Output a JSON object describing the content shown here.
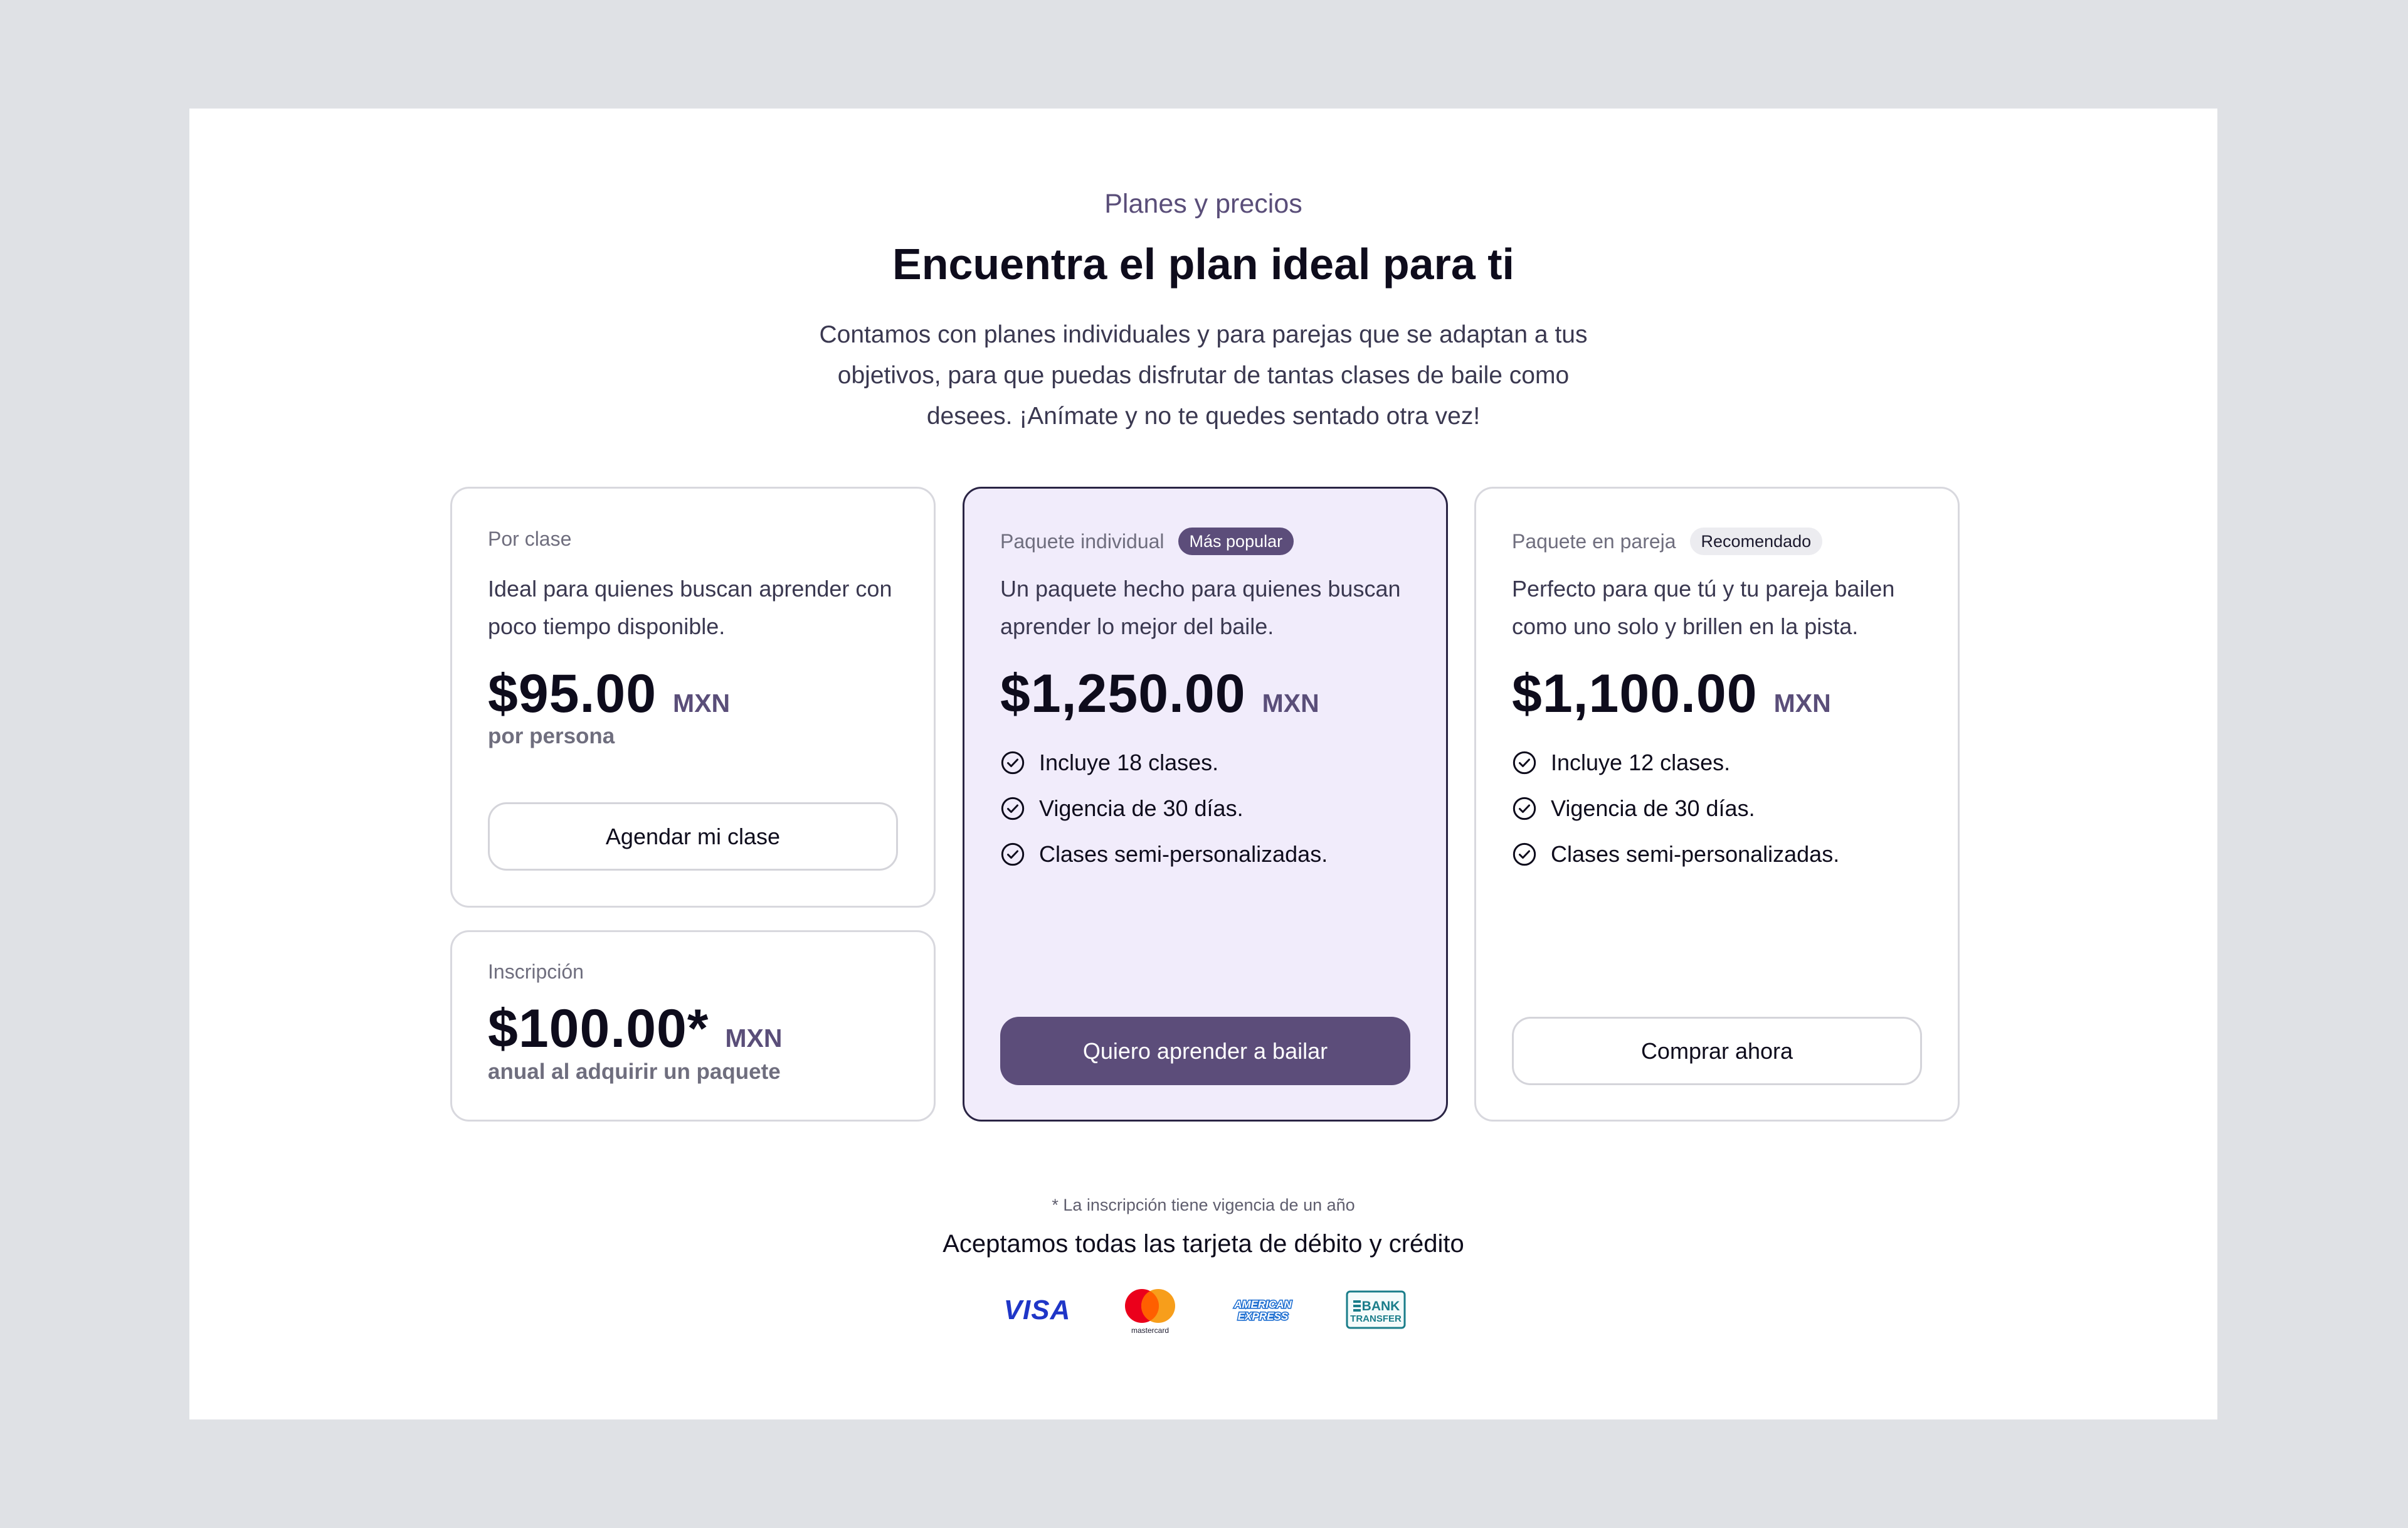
{
  "header": {
    "eyebrow": "Planes y precios",
    "title": "Encuentra el plan ideal para ti",
    "description": "Contamos con planes individuales y para parejas que se adaptan a tus objetivos, para que puedas disfrutar de tantas clases de baile como desees. ¡Anímate y no te quedes sentado otra vez!"
  },
  "plans": {
    "per_class": {
      "name": "Por clase",
      "description": "Ideal para quienes buscan aprender con poco tiempo disponible.",
      "price": "$95.00",
      "currency": "MXN",
      "note": "por persona",
      "button": "Agendar mi clase"
    },
    "enrollment": {
      "name": "Inscripción",
      "price": "$100.00*",
      "currency": "MXN",
      "note": "anual al adquirir un paquete"
    },
    "individual": {
      "name": "Paquete individual",
      "badge": "Más popular",
      "description": "Un paquete hecho para quienes buscan aprender lo mejor del baile.",
      "price": "$1,250.00",
      "currency": "MXN",
      "features": [
        "Incluye 18 clases.",
        "Vigencia de 30 días.",
        "Clases semi-personalizadas."
      ],
      "button": "Quiero aprender a bailar"
    },
    "couple": {
      "name": "Paquete en pareja",
      "badge": "Recomendado",
      "description": "Perfecto para que tú y tu pareja bailen como uno solo y brillen en la pista.",
      "price": "$1,100.00",
      "currency": "MXN",
      "features": [
        "Incluye 12 clases.",
        "Vigencia de 30 días.",
        "Clases semi-personalizadas."
      ],
      "button": "Comprar ahora"
    }
  },
  "footer": {
    "fineprint": "* La inscripción tiene vigencia de un año",
    "accept": "Aceptamos todas las tarjeta de débito y crédito",
    "payment_logos": {
      "visa": "VISA",
      "mastercard": "mastercard",
      "amex_top": "AMERICAN",
      "amex_bottom": "EXPRESS",
      "bank_top": "BANK",
      "bank_bottom": "TRANSFER"
    }
  },
  "colors": {
    "accent": "#5c4d7a",
    "featured_bg": "#f1ecfb",
    "page_bg": "#dfe1e5"
  }
}
